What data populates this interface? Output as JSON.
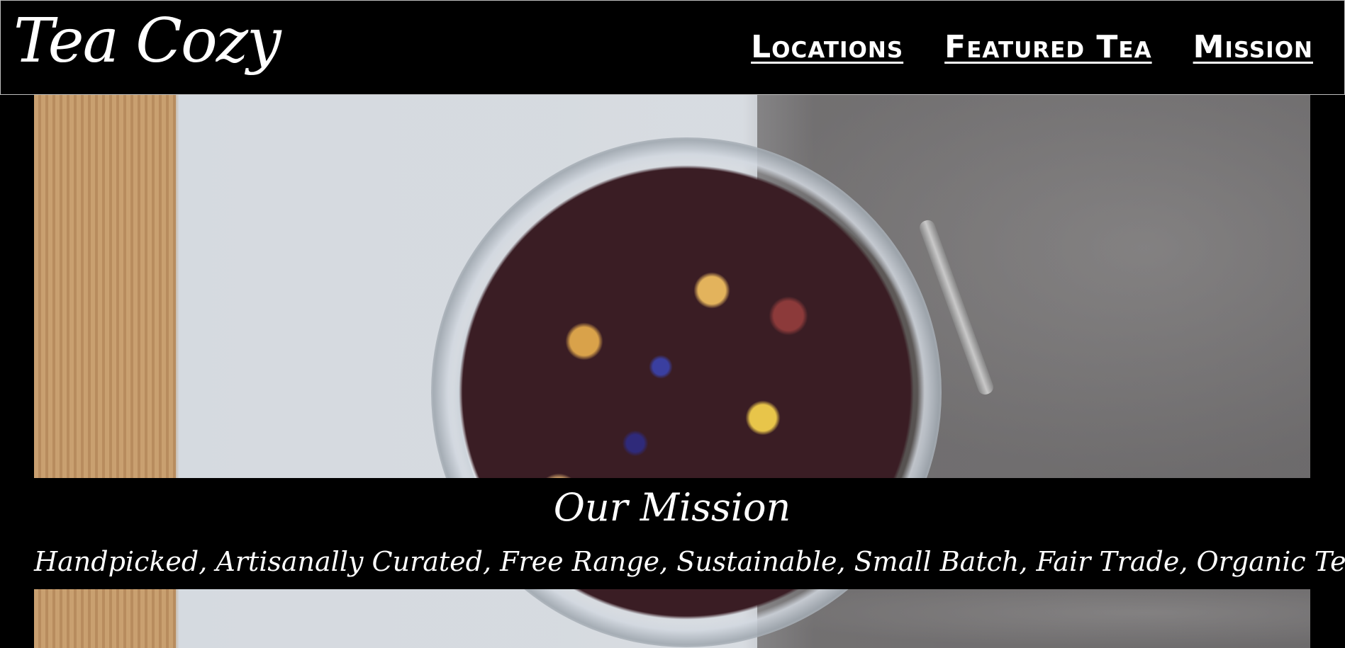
{
  "header": {
    "logo": "Tea Cozy",
    "nav": [
      {
        "label": "Locations"
      },
      {
        "label": "Featured Tea"
      },
      {
        "label": "Mission"
      }
    ]
  },
  "mission": {
    "title": "Our Mission",
    "text": "Handpicked, Artisanally Curated, Free Range, Sustainable, Small Batch, Fair Trade, Organic Tea"
  }
}
